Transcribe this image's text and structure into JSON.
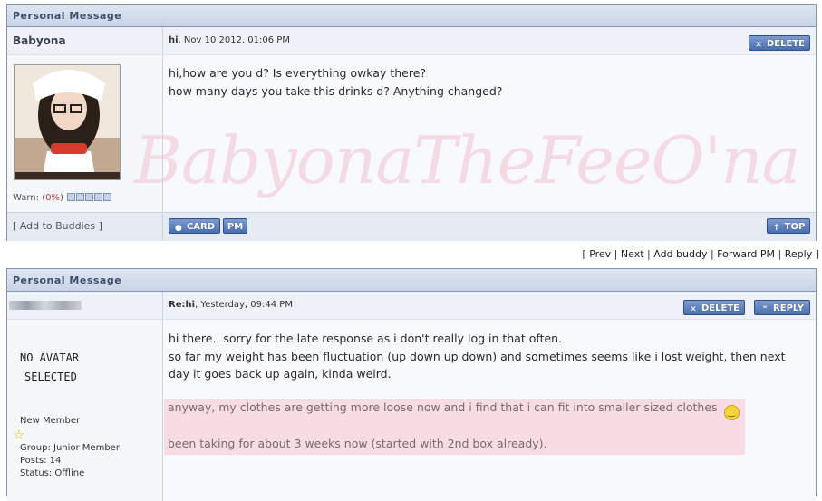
{
  "post1": {
    "header": "Personal Message",
    "username": "Babyona",
    "title_bold": "hi",
    "title_rest": ", Nov 10 2012, 01:06 PM",
    "delete_label": "DELETE",
    "message_lines": [
      "hi,how are you d? Is everything owkay there?",
      "how many days you take this drinks d? Anything changed?"
    ],
    "watermark": "BabyonaTheFeeO'na",
    "warn_label": "Warn: (",
    "warn_pct": "0%",
    "warn_close": ")",
    "add_buddies": "[ Add to Buddies ]",
    "card_label": "CARD",
    "pm_label": "PM",
    "top_label": "TOP"
  },
  "nav": {
    "prev": "Prev",
    "next": "Next",
    "add_buddy": "Add buddy",
    "forward": "Forward PM",
    "reply": "Reply"
  },
  "post2": {
    "header": "Personal Message",
    "title_bold": "Re:hi",
    "title_rest": ", Yesterday, 09:44 PM",
    "delete_label": "DELETE",
    "reply_label": "REPLY",
    "no_avatar_line1": "NO AVATAR",
    "no_avatar_line2": "SELECTED",
    "rank": "New Member",
    "group": "Group: Junior Member",
    "posts": "Posts: 14",
    "status": "Status: Offline",
    "message_lines": [
      "hi there.. sorry for the late response as i don't really log in that often.",
      "so far my weight has been fluctuation (up down up down) and sometimes seems like i lost weight, then next",
      "day it goes back up again, kinda weird."
    ],
    "quote_lines": [
      "anyway, my clothes are getting more loose now and i find that i can fit into smaller sized clothes",
      "been taking for about 3 weeks now (started with 2nd box already)."
    ]
  },
  "colors": {
    "header_bg": "#c9d4e6",
    "border": "#8395b3",
    "quote_bg": "#f7dde3",
    "watermark": "#f2c4d0"
  }
}
